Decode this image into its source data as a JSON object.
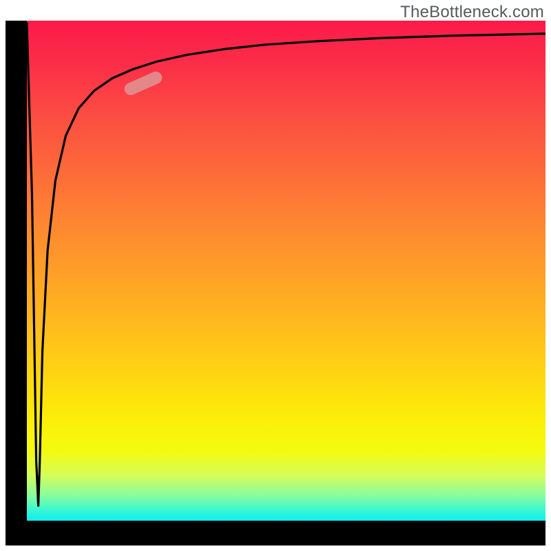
{
  "watermark": "TheBottleneck.com",
  "chart_data": {
    "type": "line",
    "title": "",
    "xlabel": "",
    "ylabel": "",
    "grid": false,
    "legend": false,
    "xlim": [
      0,
      1
    ],
    "ylim": [
      0,
      1
    ],
    "comment": "No axis ticks or numeric labels are visible in the image. Values below are normalized 0-1 positions estimated from the pixels: the curve plunges from top-left to near the bottom at x≈0.02 then rises sharply and asymptotically toward y≈0.97.",
    "series": [
      {
        "name": "curve",
        "x": [
          0.0,
          0.01,
          0.018,
          0.022,
          0.025,
          0.03,
          0.04,
          0.055,
          0.075,
          0.1,
          0.13,
          0.165,
          0.205,
          0.25,
          0.31,
          0.38,
          0.46,
          0.56,
          0.68,
          0.82,
          1.0
        ],
        "y": [
          0.995,
          0.65,
          0.12,
          0.03,
          0.12,
          0.34,
          0.54,
          0.68,
          0.77,
          0.825,
          0.86,
          0.885,
          0.903,
          0.918,
          0.932,
          0.943,
          0.952,
          0.959,
          0.965,
          0.97,
          0.974
        ]
      }
    ],
    "marker": {
      "comment": "small rounded pill on the upper-left part of the rising curve",
      "center_x_norm": 0.225,
      "center_y_norm": 0.875,
      "rotation_deg": -24,
      "color": "#dd9898"
    },
    "gradient_stops": [
      {
        "pos": 0.0,
        "color": "#fb1a4a"
      },
      {
        "pos": 0.4,
        "color": "#fe8a30"
      },
      {
        "pos": 0.8,
        "color": "#fcef08"
      },
      {
        "pos": 1.0,
        "color": "#0ceef0"
      }
    ]
  }
}
